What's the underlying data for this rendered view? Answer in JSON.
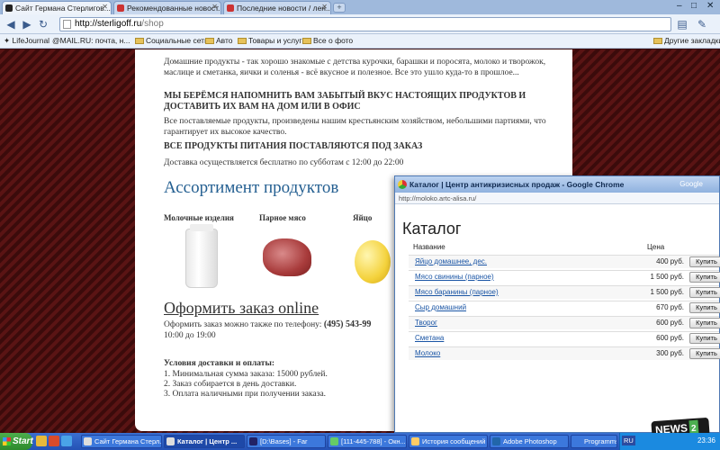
{
  "browser": {
    "tabs": [
      {
        "title": "Сайт Германа Стерлигов..."
      },
      {
        "title": "Рекомендованные новост..."
      },
      {
        "title": "Последние новости / лен..."
      }
    ],
    "url_host": "http://sterligoff.ru",
    "url_path": "/shop",
    "bookmarks": [
      {
        "label": "LifeJournal"
      },
      {
        "label": "@MAIL.RU: почта, н..."
      },
      {
        "label": "Социальные сети"
      },
      {
        "label": "Авто"
      },
      {
        "label": "Товары и услуги"
      },
      {
        "label": "Все о фото"
      }
    ],
    "other_bookmarks": "Другие закладки"
  },
  "page": {
    "intro": "Домашние продукты - так хорошо знакомые с детства курочки, барашки и поросята, молоко и творожок, маслице и сметанка, яички и соленья - всё вкусное и полезное. Все это ушло куда-то в прошлое...",
    "heading1": "МЫ БЕРЁМСЯ НАПОМНИТЬ ВАМ ЗАБЫТЫЙ ВКУС НАСТОЯЩИХ ПРОДУКТОВ И ДОСТАВИТЬ ИХ ВАМ НА ДОМ ИЛИ В ОФИС",
    "para2": "Все поставляемые продукты, произведены нашим крестьянским хозяйством, небольшими партиями, что гарантирует их высокое качество.",
    "heading2": "ВСЕ ПРОДУКТЫ ПИТАНИЯ ПОСТАВЛЯЮТСЯ ПОД ЗАКАЗ",
    "delivery": "Доставка осуществляется бесплатно по субботам с 12:00 до 22:00",
    "assortment_title": "Ассортимент продуктов",
    "products": [
      {
        "label": "Молочные изделия"
      },
      {
        "label": "Парное мясо"
      },
      {
        "label": "Яйцо"
      }
    ],
    "order_title": "Оформить заказ online",
    "order_text": "Оформить заказ можно также по телефону: ",
    "order_phone": "(495) 543-99",
    "order_hours": "10:00 до 19:00",
    "conditions_title": "Условия доставки и оплаты:",
    "conditions": [
      "1. Минимальная сумма заказа: 15000 рублей.",
      "2. Заказ собирается в день доставки.",
      "3. Оплата наличными при получении заказа."
    ]
  },
  "popup": {
    "title": "Каталог | Центр антикризисных продаж - Google Chrome",
    "brand": "Google",
    "url": "http://moloko.artc-alisa.ru/",
    "heading": "Каталог",
    "col_name": "Название",
    "col_price": "Цена",
    "buy_label": "Купить",
    "rows": [
      {
        "name": "Яйцо домашнее, дес.",
        "price": "400 руб."
      },
      {
        "name": "Мясо свинины (парное)",
        "price": "1 500 руб."
      },
      {
        "name": "Мясо баранины (парное)",
        "price": "1 500 руб."
      },
      {
        "name": "Сыр домашний",
        "price": "670 руб."
      },
      {
        "name": "Творог",
        "price": "600 руб."
      },
      {
        "name": "Сметана",
        "price": "600 руб."
      },
      {
        "name": "Молоко",
        "price": "300 руб."
      }
    ]
  },
  "taskbar": {
    "start": "Start",
    "tasks": [
      {
        "label": "Сайт Германа Стерл..."
      },
      {
        "label": "Каталог | Центр ..."
      },
      {
        "label": "[D:\\Bases] - Far"
      },
      {
        "label": "[111-445-788] - Окн..."
      },
      {
        "label": "История сообщений"
      },
      {
        "label": "Adobe Photoshop"
      },
      {
        "label": "Programms"
      }
    ],
    "lang": "RU",
    "clock": "23:36"
  },
  "watermark": {
    "text": "NEWS",
    "num": "2"
  }
}
